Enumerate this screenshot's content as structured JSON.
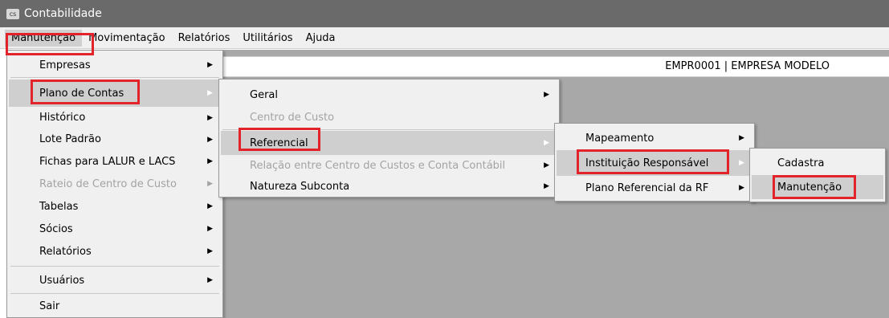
{
  "window": {
    "title": "Contabilidade",
    "icon": "app-window-icon"
  },
  "menubar": {
    "items": [
      {
        "label": "Manutenção"
      },
      {
        "label": "Movimentação"
      },
      {
        "label": "Relatórios"
      },
      {
        "label": "Utilitários"
      },
      {
        "label": "Ajuda"
      }
    ]
  },
  "company": {
    "label": "EMPR0001 | EMPRESA MODELO"
  },
  "menu_manutencao": {
    "items": [
      {
        "label": "Empresas",
        "submenu": true
      },
      {
        "label": "Plano de Contas",
        "submenu": true,
        "highlighted": true
      },
      {
        "label": "Histórico",
        "submenu": true
      },
      {
        "label": "Lote Padrão",
        "submenu": true
      },
      {
        "label": "Fichas para LALUR e LACS",
        "submenu": true
      },
      {
        "label": "Rateio de Centro de Custo",
        "submenu": true,
        "disabled": true
      },
      {
        "label": "Tabelas",
        "submenu": true
      },
      {
        "label": "Sócios",
        "submenu": true
      },
      {
        "label": "Relatórios",
        "submenu": true
      },
      {
        "label": "Usuários",
        "submenu": true
      },
      {
        "label": "Sair",
        "submenu": false
      }
    ]
  },
  "menu_plano_contas": {
    "items": [
      {
        "label": "Geral",
        "submenu": true
      },
      {
        "label": "Centro de Custo",
        "submenu": false,
        "disabled": true
      },
      {
        "label": "Referencial",
        "submenu": true,
        "highlighted": true
      },
      {
        "label": "Relação entre Centro de Custos e Conta Contábil",
        "submenu": true,
        "disabled": true
      },
      {
        "label": "Natureza Subconta",
        "submenu": true
      }
    ]
  },
  "menu_referencial": {
    "items": [
      {
        "label": "Mapeamento",
        "submenu": true
      },
      {
        "label": "Instituição Responsável",
        "submenu": true,
        "highlighted": true
      },
      {
        "label": "Plano Referencial da RF",
        "submenu": true
      }
    ]
  },
  "menu_instituicao": {
    "items": [
      {
        "label": "Cadastra"
      },
      {
        "label": "Manutenção",
        "highlighted": true
      }
    ]
  },
  "colors": {
    "highlight_box": "#e2232a",
    "titlebar": "#6a6a6a",
    "menu_bg": "#f0f0f0",
    "client_bg": "#a8a8a8"
  }
}
